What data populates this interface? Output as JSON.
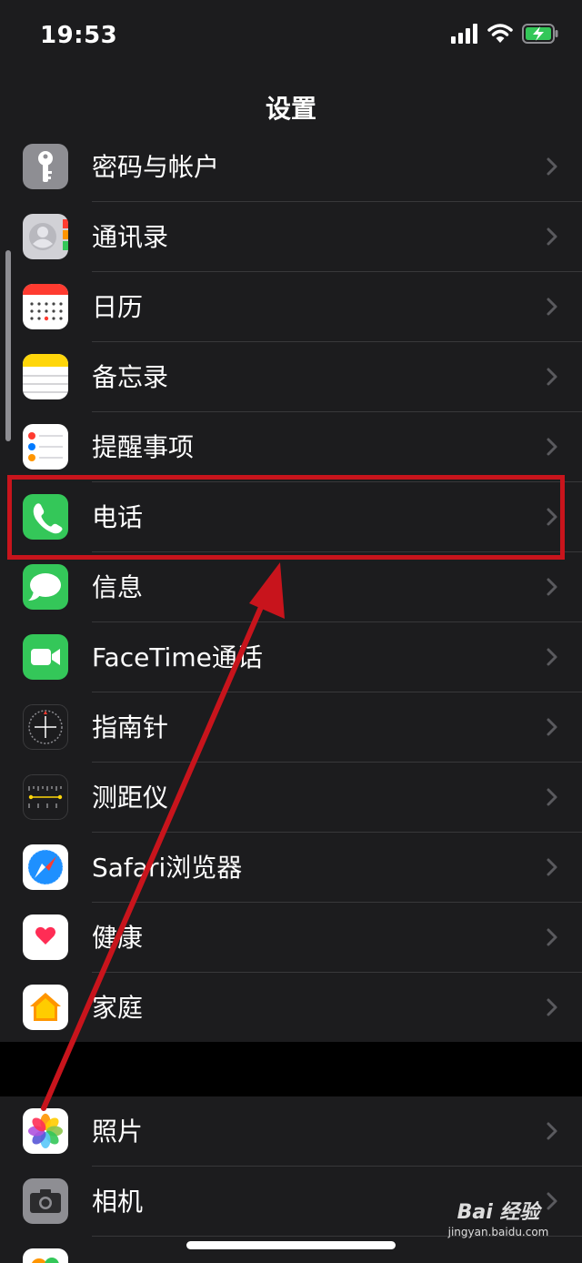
{
  "status_bar": {
    "time": "19:53"
  },
  "nav": {
    "title": "设置"
  },
  "groups": [
    {
      "items": [
        {
          "label": "密码与帐户",
          "icon": "key-icon"
        },
        {
          "label": "通讯录",
          "icon": "contacts-icon"
        },
        {
          "label": "日历",
          "icon": "calendar-icon"
        },
        {
          "label": "备忘录",
          "icon": "notes-icon"
        },
        {
          "label": "提醒事项",
          "icon": "reminders-icon"
        },
        {
          "label": "电话",
          "icon": "phone-icon"
        },
        {
          "label": "信息",
          "icon": "messages-icon"
        },
        {
          "label": "FaceTime通话",
          "icon": "facetime-icon"
        },
        {
          "label": "指南针",
          "icon": "compass-icon"
        },
        {
          "label": "测距仪",
          "icon": "measure-icon"
        },
        {
          "label": "Safari浏览器",
          "icon": "safari-icon"
        },
        {
          "label": "健康",
          "icon": "health-icon"
        },
        {
          "label": "家庭",
          "icon": "home-icon"
        }
      ]
    },
    {
      "items": [
        {
          "label": "照片",
          "icon": "photos-icon"
        },
        {
          "label": "相机",
          "icon": "camera-icon"
        }
      ]
    }
  ],
  "watermark": {
    "brand": "Bai 经验",
    "url": "jingyan.baidu.com"
  },
  "colors": {
    "highlight": "#c8141c",
    "arrow": "#c8141c",
    "row_bg": "#1c1c1e",
    "separator": "#38383a",
    "phone_green": "#34c759"
  }
}
